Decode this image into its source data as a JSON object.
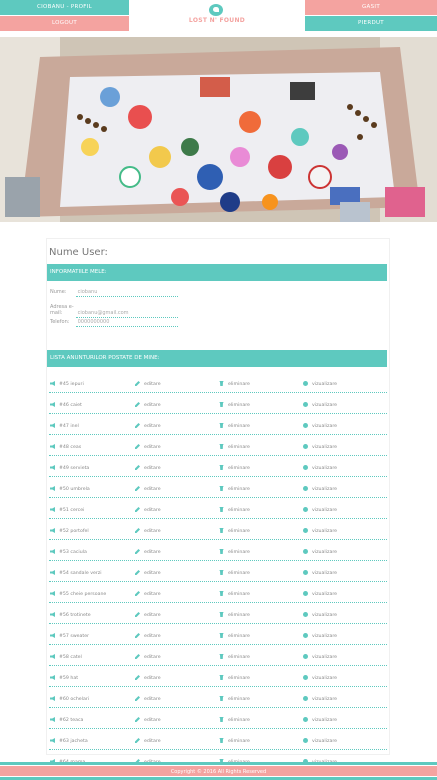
{
  "nav": {
    "profile_label": "CIOBANU - PROFIL",
    "logout_label": "LOGOUT",
    "found_label": "GASIT",
    "lost_label": "PIERDUT"
  },
  "logo": {
    "text": "LOST N' FOUND"
  },
  "colors": {
    "teal": "#5ec9bf",
    "pink": "#f4a3a0"
  },
  "profile": {
    "username_title": "Nume User:",
    "info_header": "INFORMATIILE MELE:",
    "fields": [
      {
        "label": "Nume:",
        "value": "ciobanu"
      },
      {
        "label": "Adresa e-mail:",
        "value": "ciobanu@gmail.com"
      },
      {
        "label": "Telefon:",
        "value": "0000000000"
      }
    ]
  },
  "posts_header": "LISTA ANUNTURILOR POSTATE DE MINE:",
  "action_labels": {
    "edit": "editare",
    "delete": "eliminare",
    "view": "vizualizare"
  },
  "posts": [
    {
      "title": "#45 iepuri"
    },
    {
      "title": "#46 caiet"
    },
    {
      "title": "#47 inel"
    },
    {
      "title": "#48 ceas"
    },
    {
      "title": "#49 servieta"
    },
    {
      "title": "#50 umbrela"
    },
    {
      "title": "#51 cercei"
    },
    {
      "title": "#52 portofel"
    },
    {
      "title": "#53 caciula"
    },
    {
      "title": "#54 sandale verzi"
    },
    {
      "title": "#55 cheie persoane"
    },
    {
      "title": "#56 trotinete"
    },
    {
      "title": "#57 sweater"
    },
    {
      "title": "#58 catel"
    },
    {
      "title": "#59 hat"
    },
    {
      "title": "#60 ochelari"
    },
    {
      "title": "#62 teaca"
    },
    {
      "title": "#63 jacheta"
    },
    {
      "title": "#64 mama"
    }
  ],
  "footer": {
    "copyright": "Copyright © 2016 All Rights Reserved"
  }
}
